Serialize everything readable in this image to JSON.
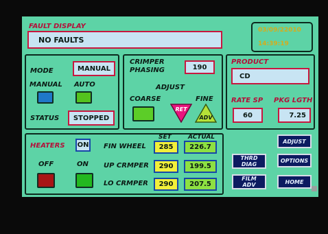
{
  "fault_display": {
    "title": "FAULT DISPLAY",
    "message": "NO FAULTS",
    "date": "03/09/22010",
    "time": "14:39:19"
  },
  "mode": {
    "label": "MODE",
    "value": "MANUAL",
    "manual_label": "MANUAL",
    "auto_label": "AUTO",
    "status_label": "STATUS",
    "status_value": "STOPPED"
  },
  "crimper": {
    "phasing_label_1": "CRIMPER",
    "phasing_label_2": "PHASING",
    "phasing_value": "190",
    "adjust_label": "ADJUST",
    "coarse_label": "COARSE",
    "fine_label": "FINE",
    "ret_label": "RET",
    "adv_label": "ADV"
  },
  "product": {
    "label": "PRODUCT",
    "value": "CD",
    "rate_sp_label": "RATE SP",
    "rate_sp_value": "60",
    "pkg_lgth_label": "PKG LGTH",
    "pkg_lgth_value": "7.25"
  },
  "heaters": {
    "label": "HEATERS",
    "state": "ON",
    "off_label": "OFF",
    "on_label": "ON",
    "set_header": "SET",
    "actual_header": "ACTUAL",
    "rows": [
      {
        "name": "FIN WHEEL",
        "set": "285",
        "actual": "226.7"
      },
      {
        "name": "UP CRMPER",
        "set": "290",
        "actual": "199.5"
      },
      {
        "name": "LO CRMPER",
        "set": "290",
        "actual": "207.5"
      }
    ]
  },
  "nav": {
    "adjust": "ADJUST",
    "thrd_diag_1": "THRD",
    "thrd_diag_2": "DIAG",
    "options": "OPTIONS",
    "film_adv_1": "FILM",
    "film_adv_2": "ADV",
    "home": "HOME"
  },
  "colors": {
    "screen_bg": "#5dd3a6",
    "label_red": "#b3103a",
    "field_bg": "#c8e4f3",
    "set_yellow": "#f2ef3a",
    "actual_green": "#8de042",
    "nav_button": "#0c1b60"
  }
}
